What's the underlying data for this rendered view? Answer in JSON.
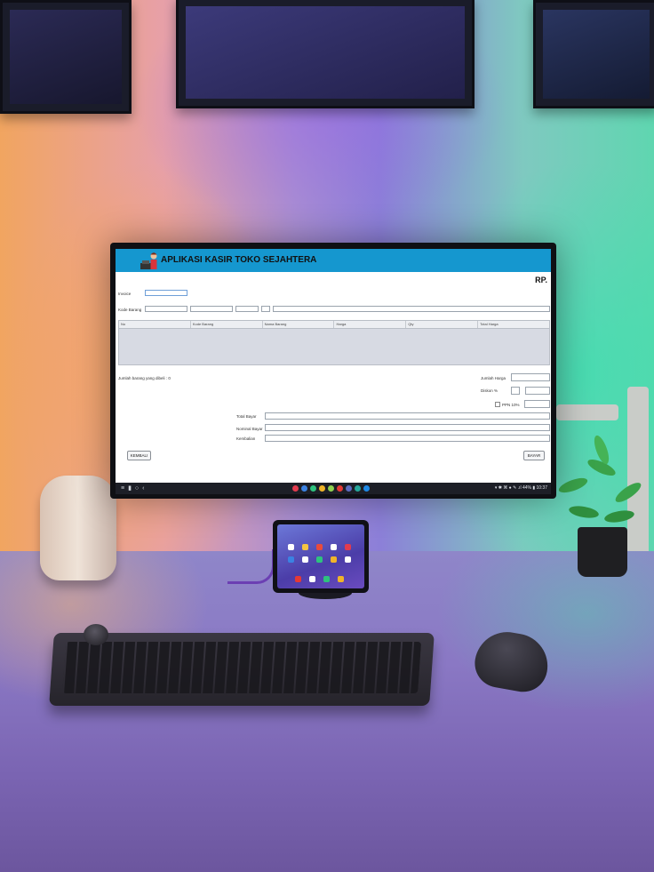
{
  "app": {
    "title": "APLIKASI KASIR TOKO SEJAHTERA",
    "currency_label": "RP.",
    "header_color": "#1597cf"
  },
  "form": {
    "invoice_label": "Invoice",
    "kode_barang_label": "Kode Barang",
    "jumlah_beli_label": "Jumlah barang yang dibeli :",
    "jumlah_beli_value": "0",
    "jumlah_harga_label": "Jumlah Harga",
    "diskon_label": "Diskon %",
    "ppn_label": "PPN 10%",
    "total_bayar_label": "Total Bayar",
    "nominal_bayar_label": "Nominal Bayar",
    "kembalian_label": "Kembalian"
  },
  "table": {
    "columns": [
      "No",
      "Kode Barang",
      "Nama Barang",
      "Harga",
      "Qty",
      "Total Harga"
    ]
  },
  "buttons": {
    "kembali": "KEMBALI",
    "bayar": "BAYAR"
  },
  "taskbar": {
    "clock": "10:37",
    "status_text": "▾ ✱ ⌘ ● ✎ .ıl 44% ▮"
  }
}
